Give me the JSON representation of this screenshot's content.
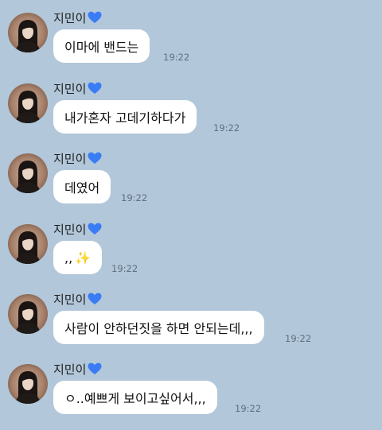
{
  "sender": {
    "name": "지민이",
    "heart_icon": "blue-heart-icon",
    "heart_color": "#3a7cf5"
  },
  "messages": [
    {
      "text": "이마에 밴드는",
      "time": "19:22"
    },
    {
      "text": "내가혼자 고데기하다가",
      "time": "19:22"
    },
    {
      "text": "데였어",
      "time": "19:22"
    },
    {
      "text": ",,",
      "emoji": "✨",
      "time": "19:22"
    },
    {
      "text": "사람이 안하던짓을 하면 안되는데,,,",
      "time": "19:22"
    },
    {
      "text": "ㅇ..예쁘게 보이고싶어서,,,",
      "time": "19:22"
    }
  ],
  "colors": {
    "background": "#b2c7d9",
    "bubble": "#ffffff",
    "time": "#5f6f7f"
  }
}
